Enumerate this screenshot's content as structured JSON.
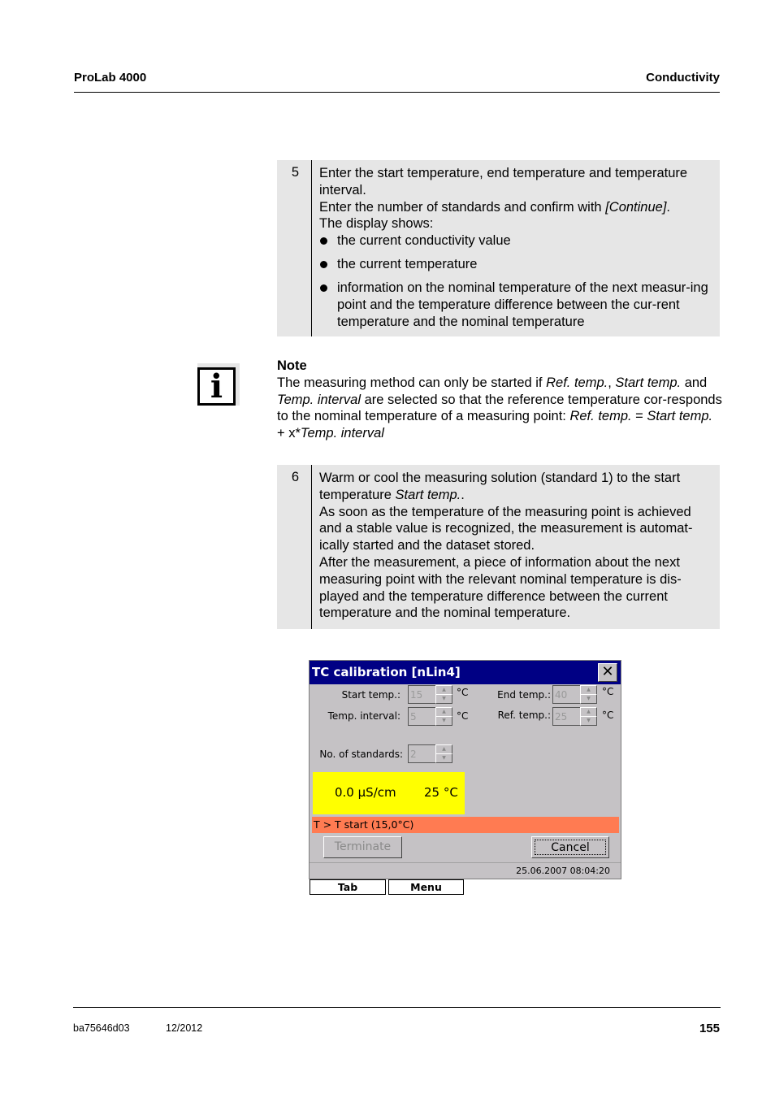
{
  "header": {
    "left": "ProLab 4000",
    "right": "Conductivity"
  },
  "step5": {
    "number": "5",
    "line1": "Enter the start temperature, end temperature and temperature interval.",
    "line2_pre": "Enter the number of standards and confirm with ",
    "line2_em": "[Continue]",
    "line2_post": ".",
    "line3": "The display shows:",
    "bullets": [
      "the current conductivity value",
      "the current temperature",
      "information on the nominal temperature of the next measur-ing point and the temperature difference between the cur-rent temperature and the nominal temperature"
    ]
  },
  "note": {
    "icon": "info-icon",
    "title": "Note",
    "t1": "The measuring method can only be started if ",
    "e1": "Ref. temp.",
    "t2": ", ",
    "e2": "Start temp.",
    "t3": " and ",
    "e3": "Temp. interval",
    "t4": " are selected so that the reference temperature cor-responds to the nominal temperature of a measuring point: ",
    "e4": "Ref. temp.",
    "t5": " = ",
    "e5": "Start temp.",
    "t6": " + x*",
    "e6": "Temp. interval"
  },
  "step6": {
    "number": "6",
    "p1_pre": "Warm or cool the measuring solution (standard 1) to the start temperature ",
    "p1_em": "Start temp.",
    "p1_post": ".",
    "p2": "As soon as the temperature of the measuring point is achieved and a stable value is recognized, the measurement is automat-ically started and the dataset stored.",
    "p3": "After the measurement, a piece of information about the next measuring point with the relevant nominal temperature is dis-played and the temperature difference between the current temperature and the nominal temperature."
  },
  "dialog": {
    "title": "TC calibration [nLin4]",
    "close_glyph": "✕",
    "fields": {
      "start_temp": {
        "label": "Start temp.:",
        "value": "15",
        "unit": "°C"
      },
      "temp_interval": {
        "label": "Temp. interval:",
        "value": "5",
        "unit": "°C"
      },
      "end_temp": {
        "label": "End temp.:",
        "value": "40",
        "unit": "°C"
      },
      "ref_temp": {
        "label": "Ref. temp.:",
        "value": "25",
        "unit": "°C"
      },
      "num_standards": {
        "label": "No. of standards:",
        "value": "2"
      }
    },
    "readout": {
      "conductivity": "0.0 µS/cm",
      "temperature": "25 °C"
    },
    "status": "T > T start (15,0°C)",
    "terminate_label": "Terminate",
    "cancel_label": "Cancel",
    "datetime": "25.06.2007 08:04:20",
    "colors": {
      "titlebar": "#000084",
      "readout": "#ffff00",
      "status": "#ff7b52"
    }
  },
  "softkeys": {
    "tab": "Tab",
    "menu": "Menu"
  },
  "footer": {
    "doc_id": "ba75646d03",
    "date": "12/2012",
    "page": "155"
  }
}
